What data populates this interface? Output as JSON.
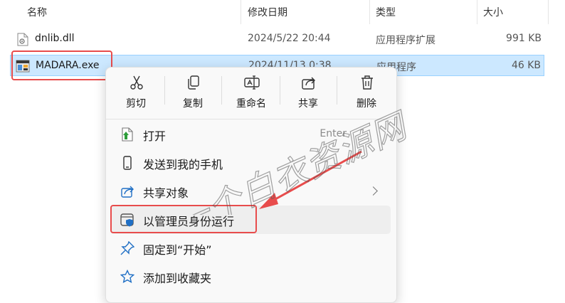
{
  "columns": {
    "name": "名称",
    "date": "修改日期",
    "type": "类型",
    "size": "大小"
  },
  "files": [
    {
      "name": "dnlib.dll",
      "date": "2024/5/22 20:44",
      "type": "应用程序扩展",
      "size": "991 KB",
      "icon": "dll-file-icon",
      "selected": false
    },
    {
      "name": "MADARA.exe",
      "date": "2024/11/13 0:38",
      "type": "应用程序",
      "size": "46 KB",
      "icon": "exe-file-icon",
      "selected": true
    }
  ],
  "context_menu": {
    "quick_actions": [
      {
        "label": "剪切",
        "icon": "scissors-icon"
      },
      {
        "label": "复制",
        "icon": "copy-icon"
      },
      {
        "label": "重命名",
        "icon": "rename-icon"
      },
      {
        "label": "共享",
        "icon": "share-icon"
      },
      {
        "label": "删除",
        "icon": "trash-icon"
      }
    ],
    "items": [
      {
        "label": "打开",
        "hint": "Enter",
        "icon": "open-file-icon"
      },
      {
        "label": "发送到我的手机",
        "icon": "phone-icon"
      },
      {
        "label": "共享对象",
        "icon": "share-icon",
        "submenu": true
      },
      {
        "label": "以管理员身份运行",
        "icon": "shield-admin-icon",
        "highlighted": true
      },
      {
        "label": "固定到“开始”",
        "icon": "pin-icon"
      },
      {
        "label": "添加到收藏夹",
        "icon": "star-icon"
      }
    ]
  },
  "watermark": {
    "text": "一个白衣资源网"
  },
  "colors": {
    "annotation_red": "#e84c4c",
    "selection_bg": "#cce8ff",
    "accent_blue": "#1f6fc5"
  }
}
